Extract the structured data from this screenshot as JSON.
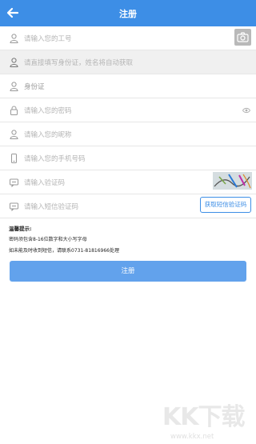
{
  "header": {
    "title": "注册",
    "back_icon": "back-arrow-icon"
  },
  "form": {
    "employee_id_placeholder": "请输入您的工号",
    "id_card_hint": "请直接填写身份证，姓名将自动获取",
    "id_card_label": "身份证",
    "password_placeholder": "请输入您的密码",
    "nickname_placeholder": "请输入您的昵称",
    "phone_placeholder": "请输入您的手机号码",
    "captcha_placeholder": "请输入验证码",
    "sms_placeholder": "请输入短信验证码",
    "sms_button": "获取短信验证码"
  },
  "notice": {
    "title": "温馨提示:",
    "line1": "密码须包含8-16位数字和大小写字母",
    "line2": "如未能及时收到短信，请联系0731-81816966处理"
  },
  "submit_label": "注册",
  "watermark": {
    "text": "KK下载",
    "url": "www.kkx.net"
  },
  "colors": {
    "primary": "#3d8ee6",
    "submit": "#62a2ec"
  }
}
